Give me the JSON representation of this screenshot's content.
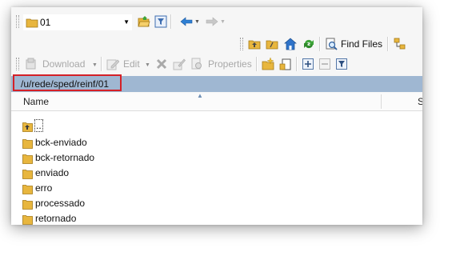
{
  "location": {
    "combo_value": "01"
  },
  "toolbar": {
    "find_files_label": "Find Files",
    "download_label": "Download",
    "edit_label": "Edit",
    "properties_label": "Properties"
  },
  "path": {
    "current": "/u/rede/sped/reinf/01"
  },
  "file_list": {
    "columns": [
      "Name",
      "S"
    ],
    "items": [
      "..",
      "bck-enviado",
      "bck-retornado",
      "enviado",
      "erro",
      "processado",
      "retornado"
    ]
  },
  "colors": {
    "path_bar": "#9fb7d2",
    "highlight_box": "#d42027",
    "folder": "#e8b63e"
  }
}
